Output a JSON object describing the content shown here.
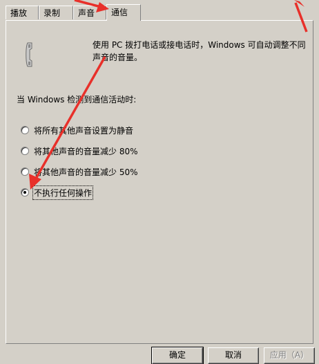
{
  "tabs": [
    {
      "label": "播放",
      "active": false
    },
    {
      "label": "录制",
      "active": false
    },
    {
      "label": "声音",
      "active": false
    },
    {
      "label": "通信",
      "active": true
    }
  ],
  "communications": {
    "description": "使用 PC 拨打电话或接电话时，Windows 可自动调整不同声音的音量。",
    "detect_label": "当 Windows 检测到通信活动时:",
    "options": [
      {
        "label": "将所有其他声音设置为静音",
        "checked": false
      },
      {
        "label": "将其他声音的音量减少 80%",
        "checked": false
      },
      {
        "label": "将其他声音的音量减少 50%",
        "checked": false
      },
      {
        "label": "不执行任何操作",
        "checked": true
      }
    ]
  },
  "buttons": {
    "ok": "确定",
    "cancel": "取消",
    "apply": "应用（A）"
  },
  "colors": {
    "dialog_bg": "#d4d0c8",
    "annotation_arrow": "#e8302a"
  },
  "icons": {
    "phone": "phone-icon"
  }
}
